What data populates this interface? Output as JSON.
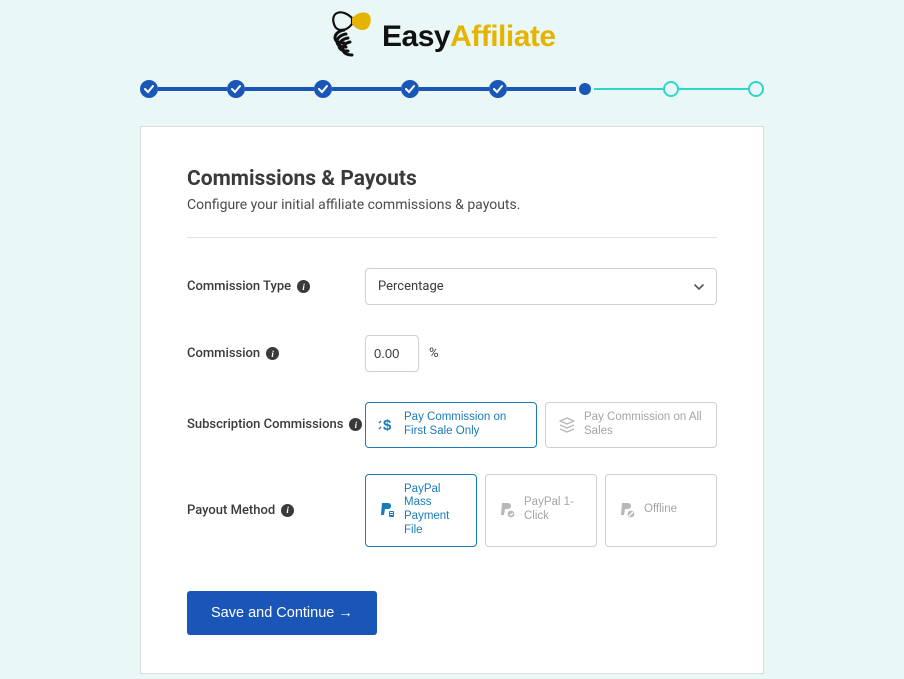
{
  "logo": {
    "brand_a": "Easy",
    "brand_b": "Affiliate"
  },
  "stepper": {
    "steps": [
      {
        "state": "done"
      },
      {
        "state": "done"
      },
      {
        "state": "done"
      },
      {
        "state": "done"
      },
      {
        "state": "done"
      },
      {
        "state": "current"
      },
      {
        "state": "future"
      },
      {
        "state": "future"
      }
    ]
  },
  "card": {
    "title": "Commissions & Payouts",
    "description": "Configure your initial affiliate commissions & payouts."
  },
  "form": {
    "commission_type": {
      "label": "Commission Type",
      "value": "Percentage"
    },
    "commission": {
      "label": "Commission",
      "value": "0.00",
      "unit": "%"
    },
    "subscription_commissions": {
      "label": "Subscription Commissions",
      "options": [
        {
          "id": "first",
          "label": "Pay Commission on First Sale Only",
          "selected": true,
          "icon": "dollar"
        },
        {
          "id": "all",
          "label": "Pay Commission on All Sales",
          "selected": false,
          "icon": "stack"
        }
      ]
    },
    "payout_method": {
      "label": "Payout Method",
      "options": [
        {
          "id": "mass",
          "label": "PayPal Mass Payment File",
          "selected": true,
          "icon": "paypal-file"
        },
        {
          "id": "oneclick",
          "label": "PayPal 1-Click",
          "selected": false,
          "icon": "paypal-click"
        },
        {
          "id": "offline",
          "label": "Offline",
          "selected": false,
          "icon": "paypal-off"
        }
      ]
    }
  },
  "actions": {
    "save_label": "Save and Continue →"
  },
  "colors": {
    "accent_blue": "#1a56b8",
    "accent_teal": "#2fd6c6",
    "brand_yellow": "#e5b400",
    "selected_border": "#1a7bb9"
  }
}
